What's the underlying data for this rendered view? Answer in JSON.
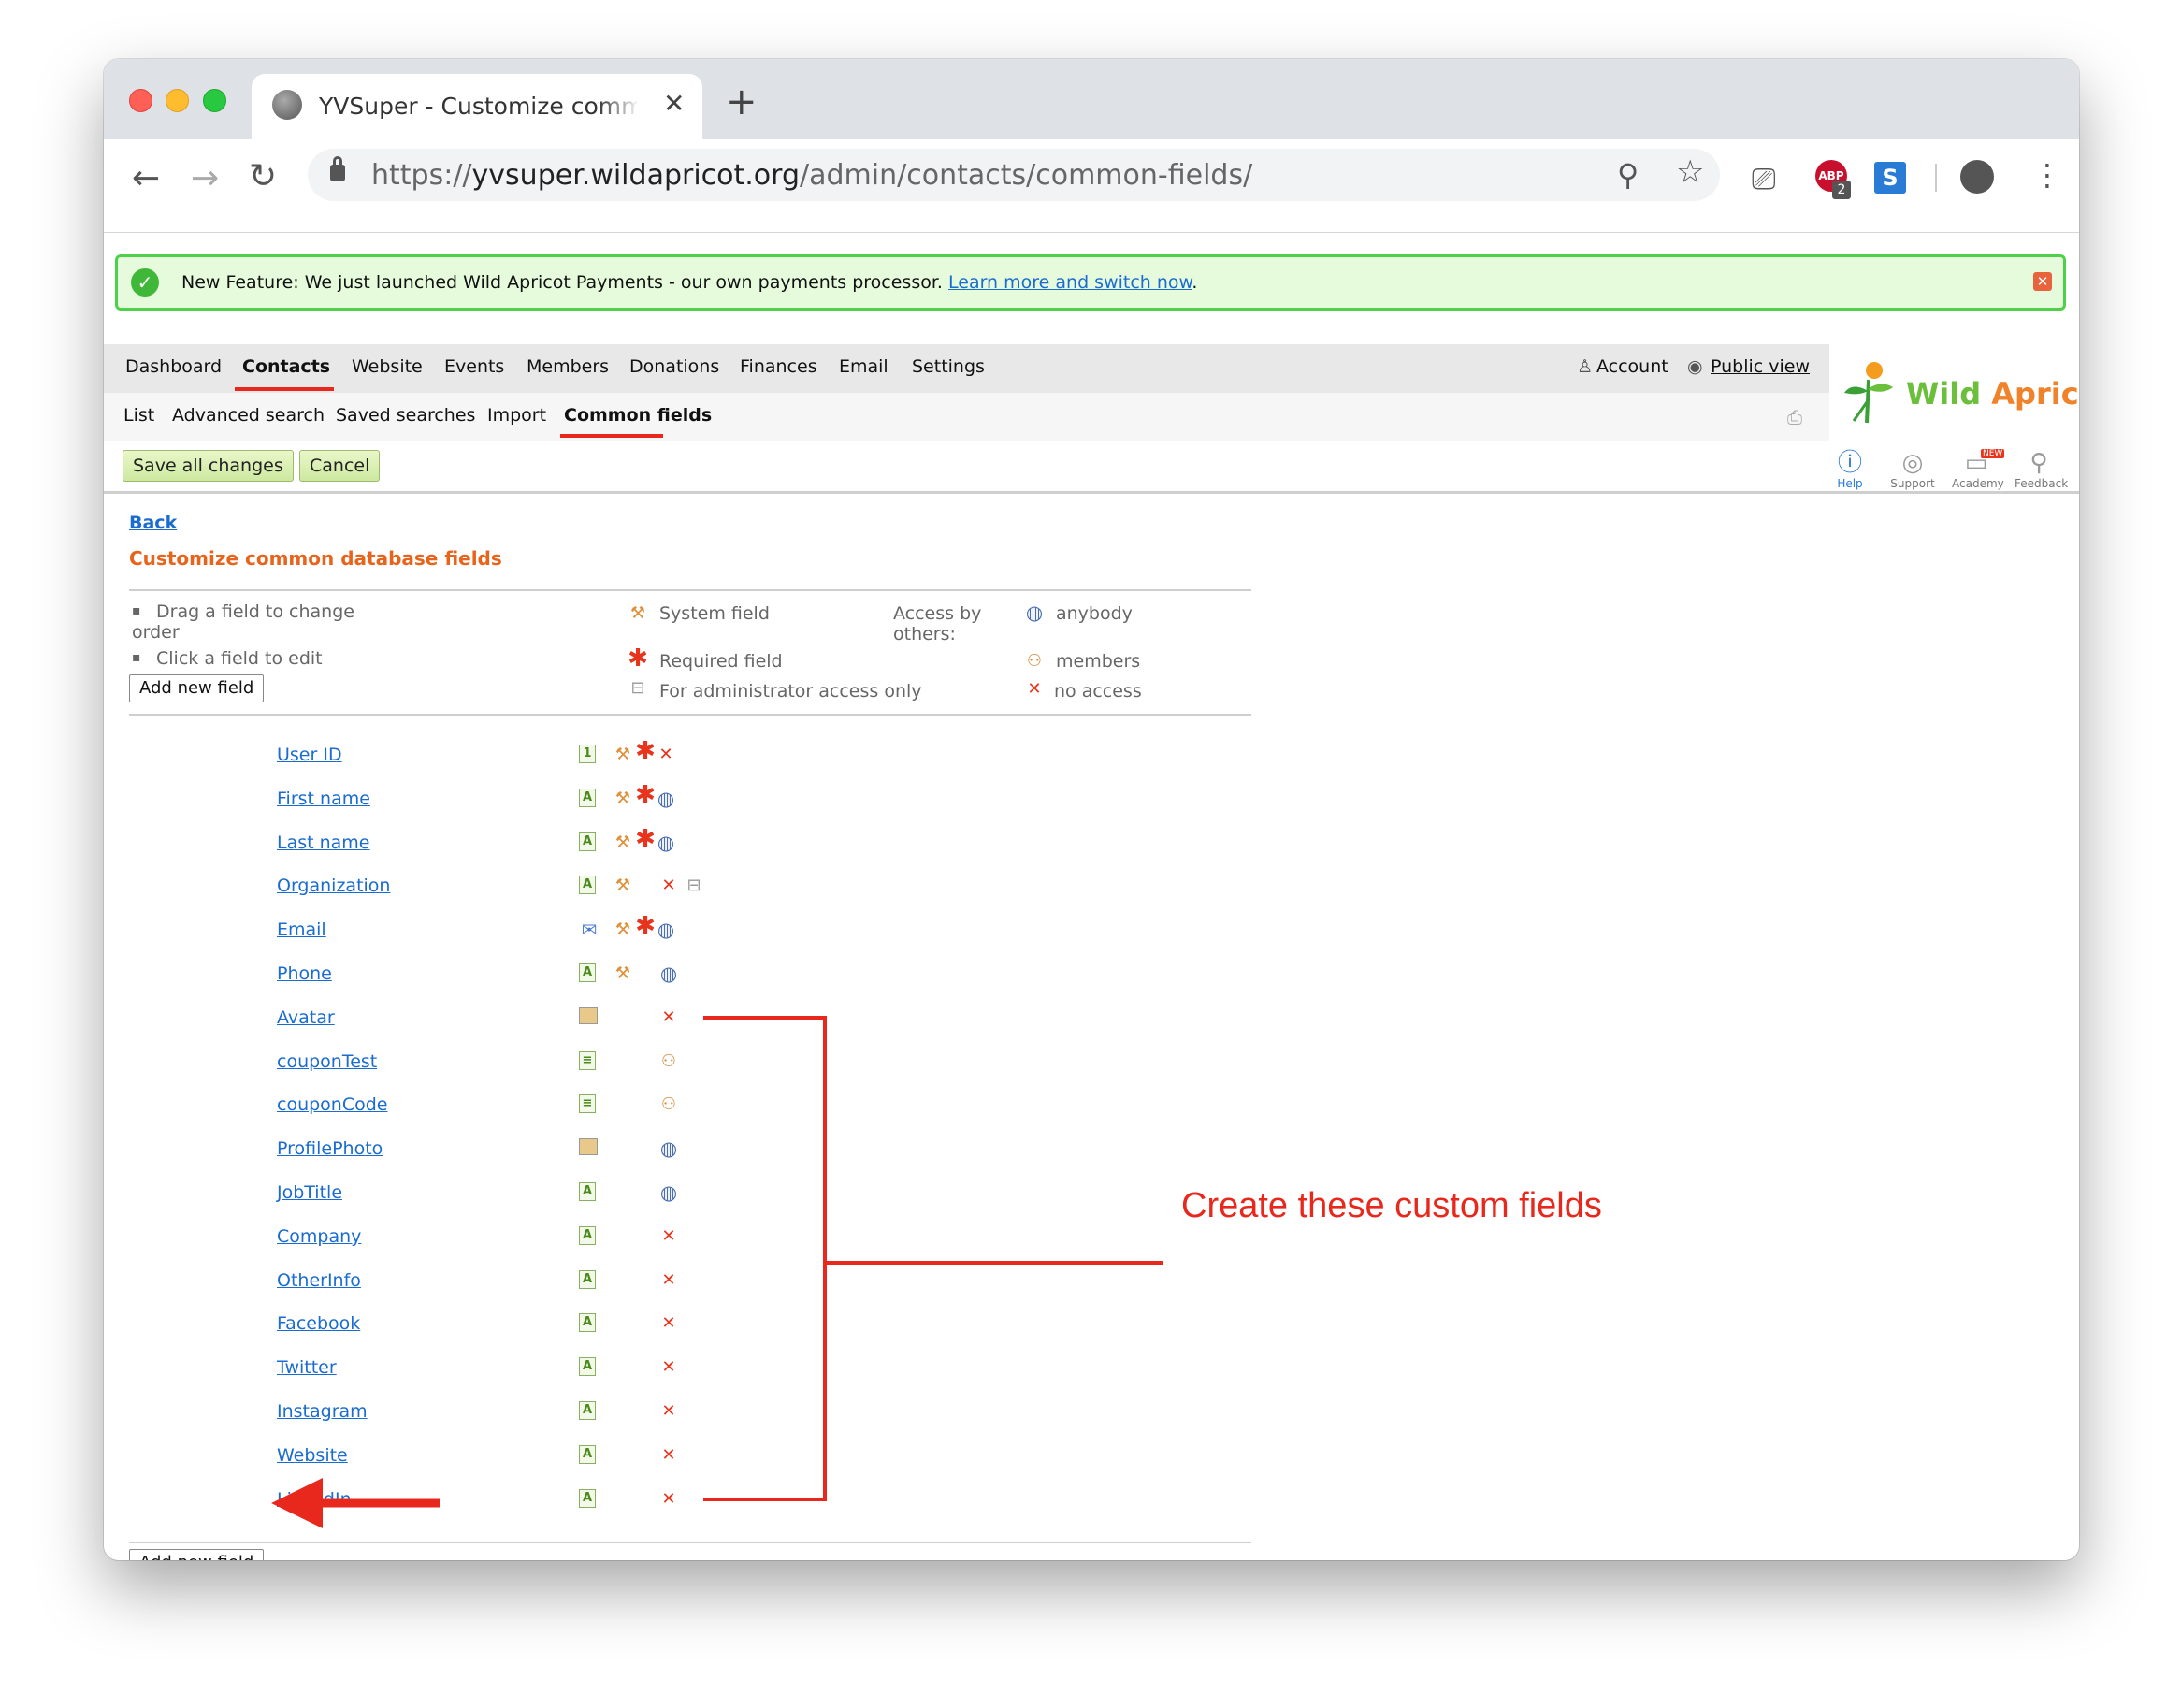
{
  "browser": {
    "tab_title": "YVSuper - Customize common",
    "new_tab_label": "+",
    "url_scheme": "https://",
    "url_host": "yvsuper.wildapricot.org",
    "url_path": "/admin/contacts/common-fields/",
    "extension_badge": "2"
  },
  "banner": {
    "text": "New Feature: We just launched Wild Apricot Payments - our own payments processor.",
    "link": "Learn more and switch now",
    "tail": "."
  },
  "nav": {
    "main": [
      "Dashboard",
      "Contacts",
      "Website",
      "Events",
      "Members",
      "Donations",
      "Finances",
      "Email",
      "Settings"
    ],
    "account": "Account",
    "public_view": "Public view",
    "sub": [
      "List",
      "Advanced search",
      "Saved searches",
      "Import",
      "Common fields"
    ]
  },
  "logo": {
    "text": "Wild Apricot"
  },
  "help_icons": [
    "Help",
    "Support",
    "Academy",
    "Feedback"
  ],
  "academy_badge": "NEW",
  "actions": {
    "save": "Save all changes",
    "cancel": "Cancel"
  },
  "page": {
    "back": "Back",
    "title": "Customize common database fields",
    "hint_drag": "Drag a field to change order",
    "hint_drag_1": "Drag a field to change",
    "hint_drag_2": "order",
    "hint_click": "Click a field to edit",
    "add_button": "Add new field",
    "legend": {
      "system": "System field",
      "required": "Required field",
      "admin_only": "For administrator access only",
      "access_label_1": "Access by",
      "access_label_2": "others:",
      "anybody": "anybody",
      "members": "members",
      "no_access": "no access"
    }
  },
  "fields": [
    {
      "name": "User ID",
      "type": "number",
      "system": true,
      "required": true,
      "access": "no-access",
      "admin_only": false
    },
    {
      "name": "First name",
      "type": "text",
      "system": true,
      "required": true,
      "access": "anybody",
      "admin_only": false
    },
    {
      "name": "Last name",
      "type": "text",
      "system": true,
      "required": true,
      "access": "anybody",
      "admin_only": false
    },
    {
      "name": "Organization",
      "type": "text",
      "system": true,
      "required": false,
      "access": "no-access",
      "admin_only": true
    },
    {
      "name": "Email",
      "type": "email",
      "system": true,
      "required": true,
      "access": "anybody",
      "admin_only": false
    },
    {
      "name": "Phone",
      "type": "text",
      "system": true,
      "required": false,
      "access": "anybody",
      "admin_only": false
    },
    {
      "name": "Avatar",
      "type": "picture",
      "system": false,
      "required": false,
      "access": "no-access",
      "admin_only": false
    },
    {
      "name": "couponTest",
      "type": "rules",
      "system": false,
      "required": false,
      "access": "members",
      "admin_only": false
    },
    {
      "name": "couponCode",
      "type": "rules",
      "system": false,
      "required": false,
      "access": "members",
      "admin_only": false
    },
    {
      "name": "ProfilePhoto",
      "type": "picture",
      "system": false,
      "required": false,
      "access": "anybody",
      "admin_only": false
    },
    {
      "name": "JobTitle",
      "type": "text",
      "system": false,
      "required": false,
      "access": "anybody",
      "admin_only": false
    },
    {
      "name": "Company",
      "type": "text",
      "system": false,
      "required": false,
      "access": "no-access",
      "admin_only": false
    },
    {
      "name": "OtherInfo",
      "type": "text",
      "system": false,
      "required": false,
      "access": "no-access",
      "admin_only": false
    },
    {
      "name": "Facebook",
      "type": "text",
      "system": false,
      "required": false,
      "access": "no-access",
      "admin_only": false
    },
    {
      "name": "Twitter",
      "type": "text",
      "system": false,
      "required": false,
      "access": "no-access",
      "admin_only": false
    },
    {
      "name": "Instagram",
      "type": "text",
      "system": false,
      "required": false,
      "access": "no-access",
      "admin_only": false
    },
    {
      "name": "Website",
      "type": "text",
      "system": false,
      "required": false,
      "access": "no-access",
      "admin_only": false
    },
    {
      "name": "LinkedIn",
      "type": "text",
      "system": false,
      "required": false,
      "access": "no-access",
      "admin_only": false
    }
  ],
  "annotation": {
    "label": "Create these custom fields",
    "color": "#e8281c"
  },
  "icons": {
    "anybody": "globe-icon",
    "members": "members-icon",
    "no-access": "no-access-icon",
    "system": "wrench-icon",
    "required": "asterisk-icon",
    "admin_only": "lock-icon"
  }
}
